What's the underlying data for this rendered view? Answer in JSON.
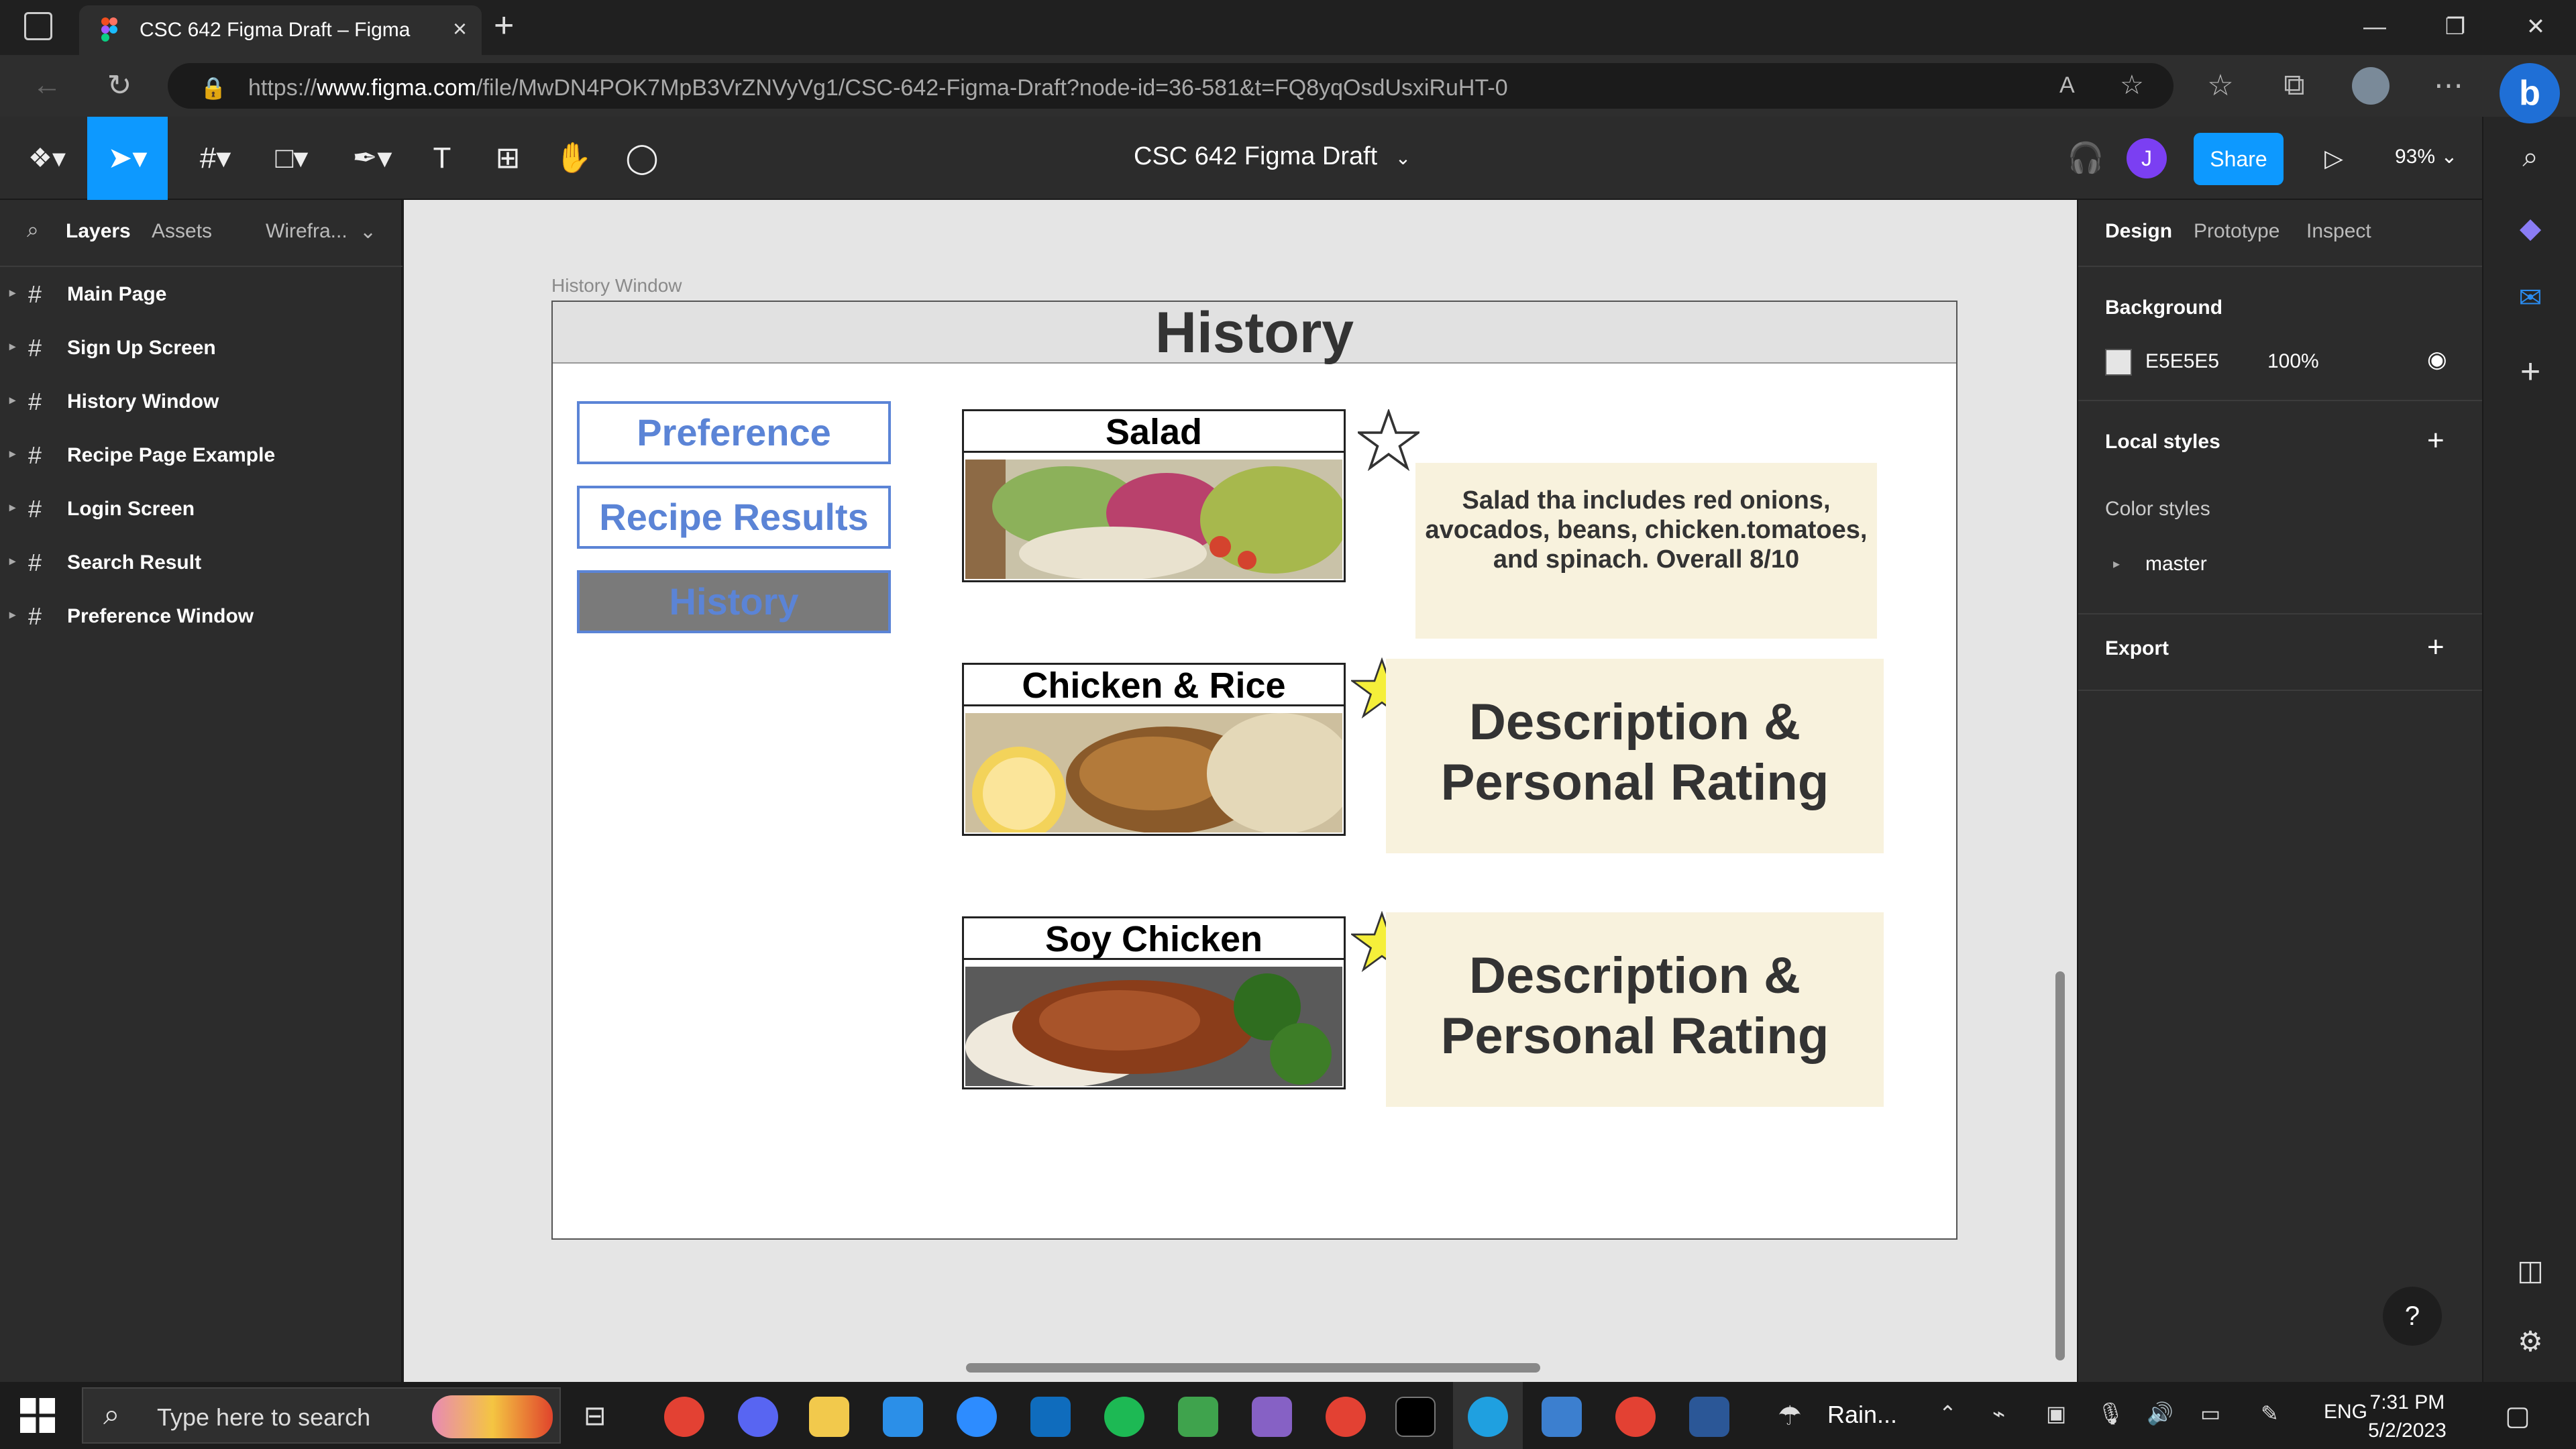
{
  "browser": {
    "tab_title": "CSC 642 Figma Draft – Figma",
    "url_prefix": "https://",
    "url_domain": "www.figma.com",
    "url_path": "/file/MwDN4POK7MpB3VrZNVyVg1/CSC-642-Figma-Draft?node-id=36-581&t=FQ8yqOsdUsxiRuHT-0"
  },
  "toolbar": {
    "file_title": "CSC 642 Figma Draft",
    "avatar_initial": "J",
    "share_label": "Share",
    "zoom": "93%"
  },
  "left_panel": {
    "tabs": [
      "Layers",
      "Assets",
      "Wirefra..."
    ],
    "layers": [
      "Main Page",
      "Sign Up Screen",
      "History Window",
      "Recipe Page Example",
      "Login Screen",
      "Search Result",
      "Preference Window"
    ]
  },
  "canvas": {
    "frame_label": "History Window",
    "header_title": "History",
    "nav_buttons": [
      "Preference",
      "Recipe Results",
      "History"
    ],
    "cards": [
      {
        "title": "Salad",
        "starred": false,
        "description": "Salad tha includes red onions, avocados, beans, chicken.tomatoes, and spinach. Overall 8/10"
      },
      {
        "title": "Chicken & Rice",
        "starred": true,
        "description": "Description & Personal Rating"
      },
      {
        "title": "Soy Chicken",
        "starred": true,
        "description": "Description & Personal Rating"
      }
    ]
  },
  "right_panel": {
    "tabs": [
      "Design",
      "Prototype",
      "Inspect"
    ],
    "background_label": "Background",
    "background_hex": "E5E5E5",
    "background_opacity": "100%",
    "local_styles_label": "Local styles",
    "color_styles_label": "Color styles",
    "master_label": "master",
    "export_label": "Export"
  },
  "taskbar": {
    "search_placeholder": "Type here to search",
    "weather": "Rain...",
    "language": "ENG",
    "time": "7:31 PM",
    "date": "5/2/2023"
  },
  "colors": {
    "figma_blue": "#0d99ff",
    "nav_blue": "#5b84d6",
    "desc_bg": "#f8f2dd",
    "star_yellow": "#f5ef3a",
    "active_nav_bg": "#7a7a7a"
  }
}
